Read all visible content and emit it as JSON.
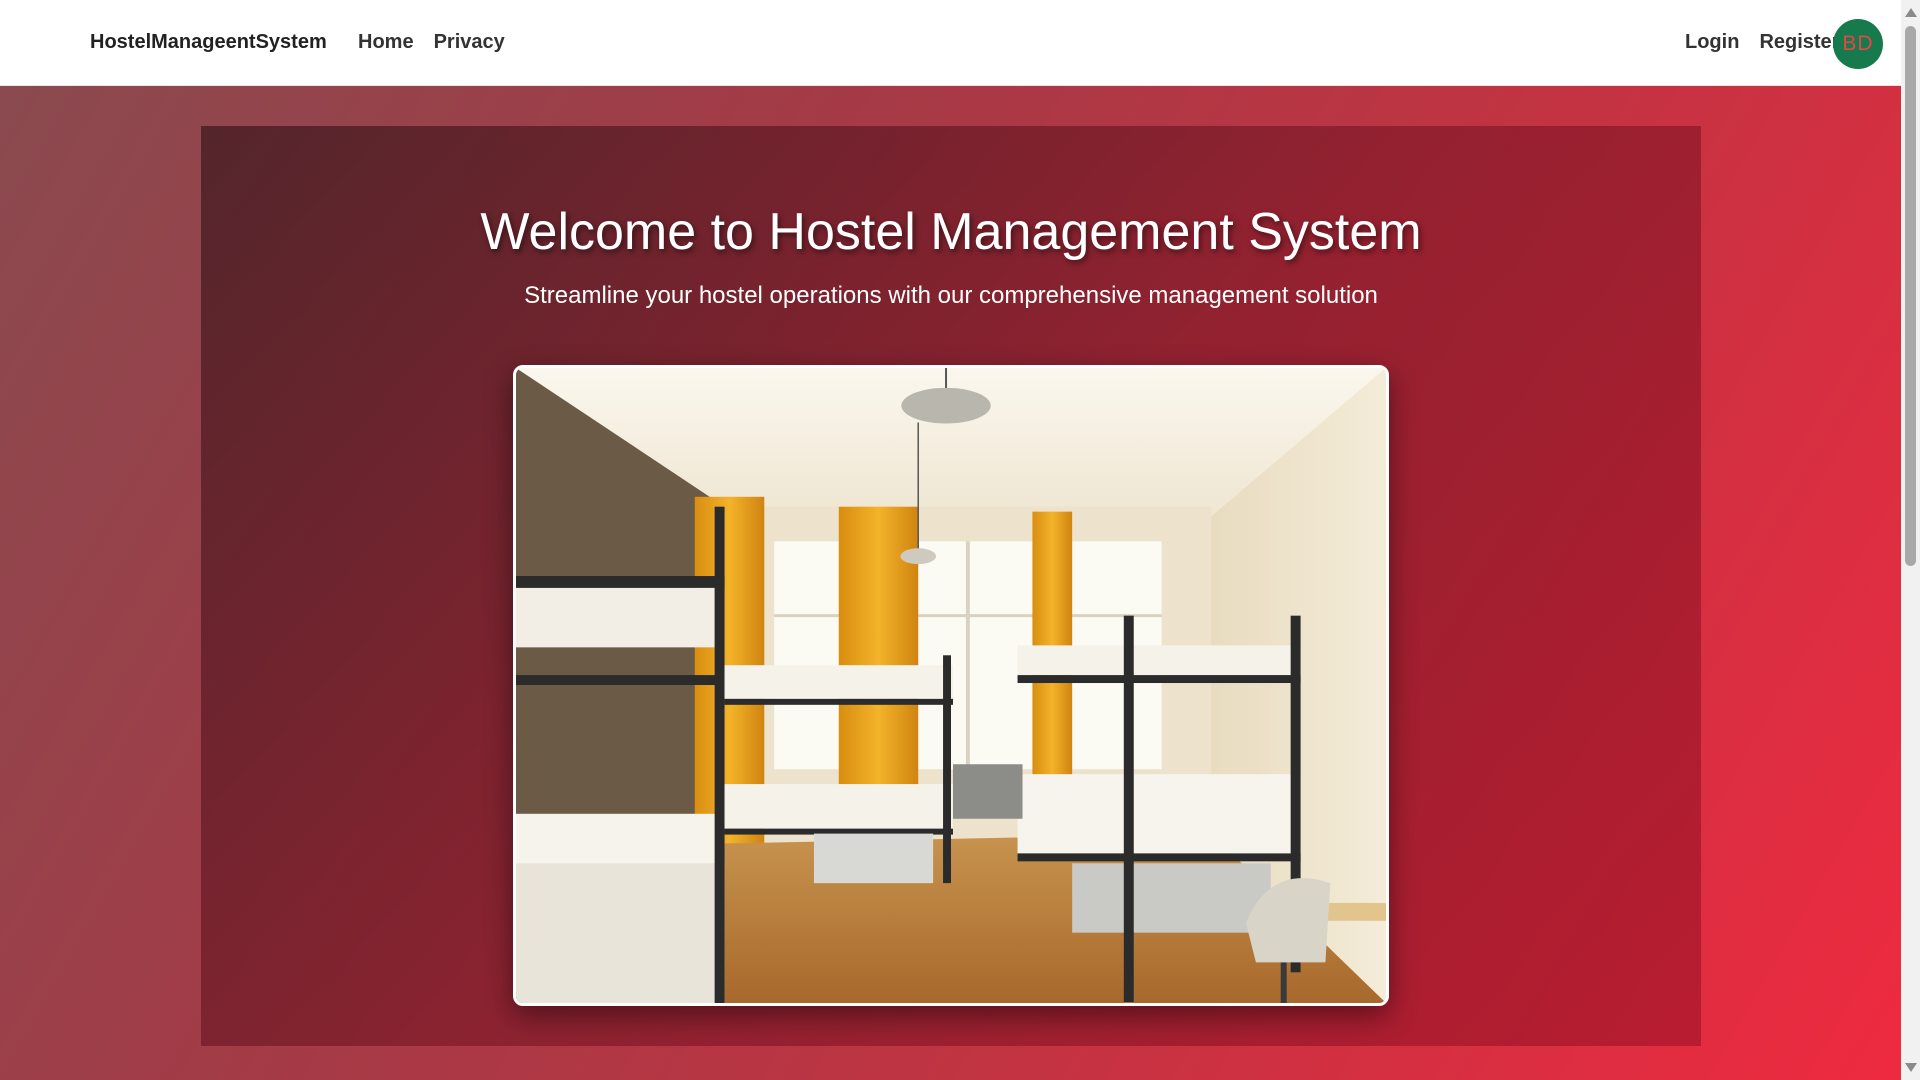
{
  "navbar": {
    "brand": "HostelManageentSystem",
    "links": [
      {
        "label": "Home"
      },
      {
        "label": "Privacy"
      }
    ],
    "auth": {
      "login": "Login",
      "register": "Register"
    },
    "avatar_initials": "BD"
  },
  "hero": {
    "title": "Welcome to Hostel Management System",
    "subtitle": "Streamline your hostel operations with our comprehensive management solution",
    "image_subject": "hostel dormitory room with bunk beds"
  },
  "colors": {
    "avatar_bg": "#177a4d",
    "avatar_text": "#e64646",
    "hero_gradient_start": "#8a4a4f",
    "hero_gradient_end": "#ee2a40"
  }
}
